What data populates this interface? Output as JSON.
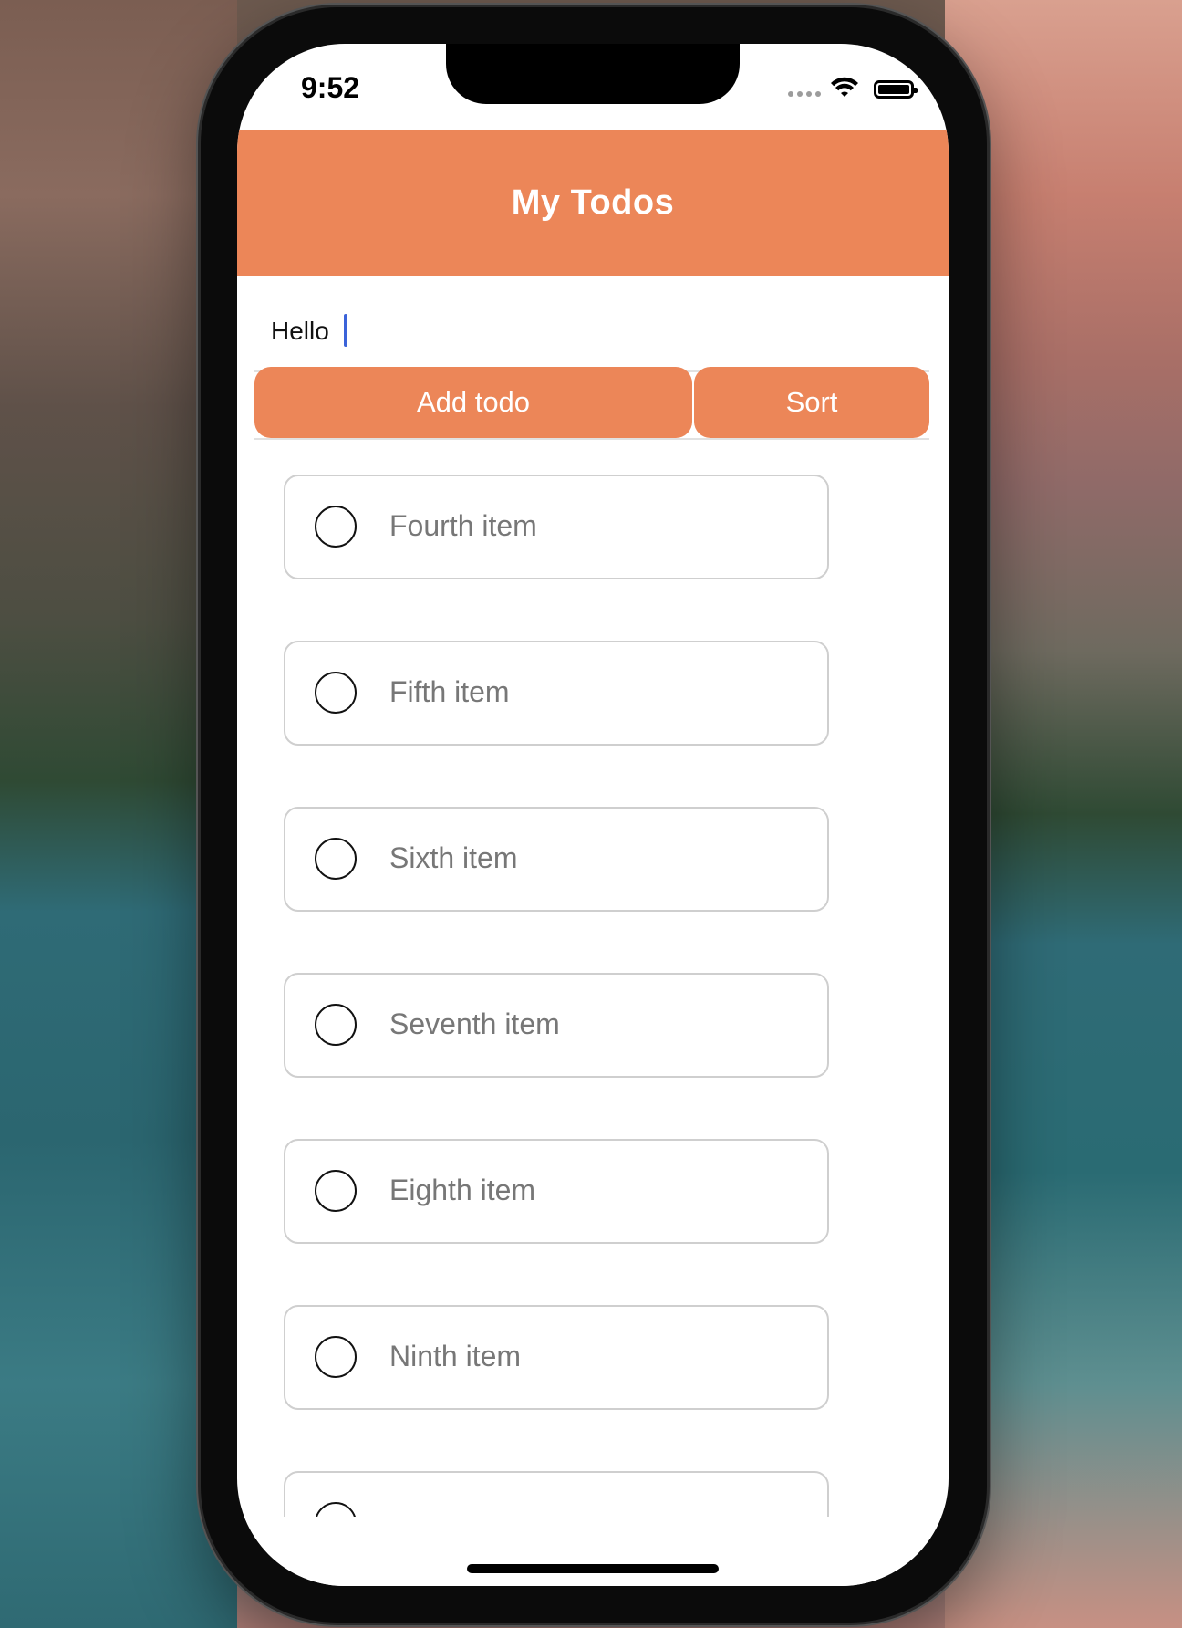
{
  "status_bar": {
    "time": "9:52"
  },
  "header": {
    "title": "My Todos"
  },
  "input": {
    "value": "Hello",
    "placeholder": ""
  },
  "buttons": {
    "add_label": "Add todo",
    "sort_label": "Sort"
  },
  "todos": [
    {
      "label": "Fourth item",
      "done": false
    },
    {
      "label": "Fifth item",
      "done": false
    },
    {
      "label": "Sixth item",
      "done": false
    },
    {
      "label": "Seventh item",
      "done": false
    },
    {
      "label": "Eighth item",
      "done": false
    },
    {
      "label": "Ninth item",
      "done": false
    },
    {
      "label": "",
      "done": false
    }
  ],
  "colors": {
    "accent": "#ec8658",
    "text_muted": "#777777",
    "border": "#cfcfcf"
  },
  "icons": [
    "wifi-icon",
    "battery-icon",
    "signal-dots-icon",
    "radio-unchecked-icon"
  ]
}
